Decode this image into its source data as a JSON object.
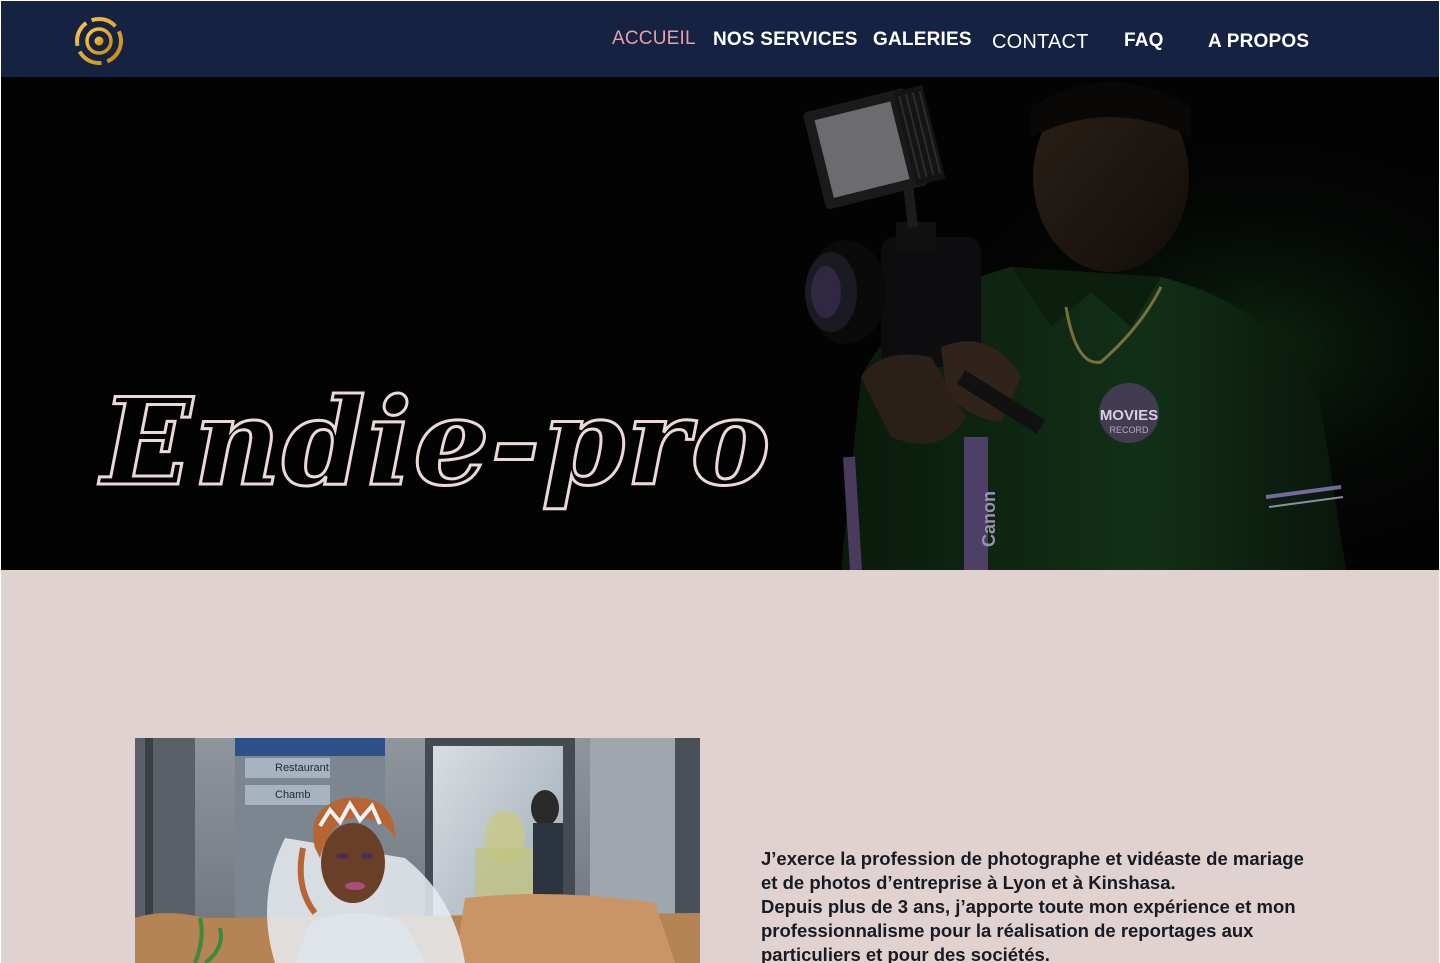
{
  "nav": {
    "items": [
      {
        "label": "ACCUEIL",
        "active": true
      },
      {
        "label": "NOS SERVICES",
        "active": false
      },
      {
        "label": "GALERIES",
        "active": false
      },
      {
        "label": "CONTACT",
        "active": false
      },
      {
        "label": "FAQ",
        "active": false
      },
      {
        "label": "A PROPOS",
        "active": false
      }
    ]
  },
  "hero": {
    "title": "Endie-pro"
  },
  "about": {
    "paragraph1": "J’exerce la profession de photographe et vidéaste de mariage et de photos d’entreprise à Lyon et à Kinshasa.",
    "paragraph2": "Depuis plus de 3 ans, j’apporte toute mon expérience et mon professionnalisme pour la réalisation de reportages aux particuliers et pour des sociétés."
  },
  "photo_labels": {
    "camera_brand": "Canon",
    "shirt_badge": "MOVIES",
    "shirt_badge_sub": "RECORD",
    "sign_restaurant": "Restaurant",
    "sign_chambres": "Chamb"
  },
  "colors": {
    "navbar_bg": "#152241",
    "nav_text": "#ffffff",
    "nav_active": "#e6a0a6",
    "hero_bg": "#030303",
    "hero_title_stroke": "#ead9d6",
    "about_bg": "#e0d2d1",
    "about_text": "#1a1a22",
    "logo_gold": "#e2a72a"
  }
}
